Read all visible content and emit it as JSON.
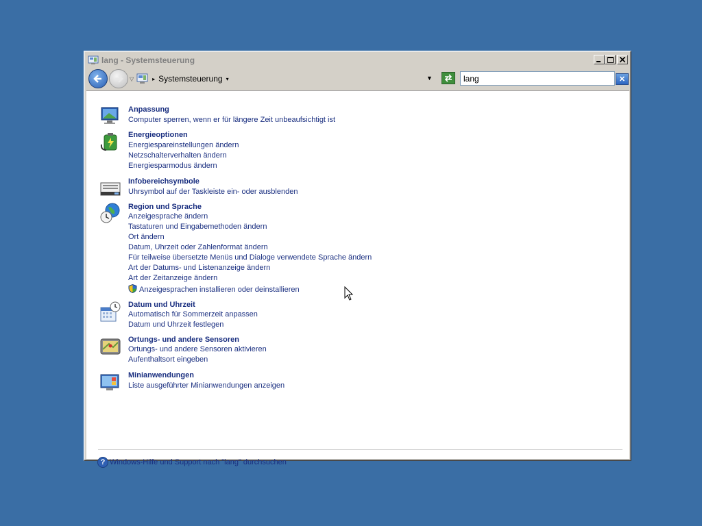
{
  "window": {
    "title": "lang - Systemsteuerung",
    "title_buttons": [
      "minimize",
      "maximize",
      "close"
    ]
  },
  "address": {
    "breadcrumb": "Systemsteuerung",
    "search_value": "lang"
  },
  "categories": [
    {
      "icon": "personalization-monitor-icon",
      "title": "Anpassung",
      "tasks": [
        "Computer sperren, wenn er für längere Zeit unbeaufsichtigt ist"
      ]
    },
    {
      "icon": "power-battery-icon",
      "title": "Energieoptionen",
      "tasks": [
        "Energiespareinstellungen ändern",
        "Netzschalterverhalten ändern",
        "Energiesparmodus ändern"
      ]
    },
    {
      "icon": "notification-area-icon",
      "title": "Infobereichsymbole",
      "tasks": [
        "Uhrsymbol auf der Taskleiste ein- oder ausblenden"
      ]
    },
    {
      "icon": "globe-clock-icon",
      "title": "Region und Sprache",
      "tasks": [
        "Anzeigesprache ändern",
        "Tastaturen und Eingabemethoden ändern",
        "Ort ändern",
        "Datum, Uhrzeit oder Zahlenformat ändern",
        "Für teilweise übersetzte Menüs und Dialoge verwendete Sprache ändern",
        "Art der Datums- und Listenanzeige ändern",
        "Art der Zeitanzeige ändern",
        "Anzeigesprachen installieren oder deinstallieren"
      ]
    },
    {
      "icon": "calendar-clock-icon",
      "title": "Datum und Uhrzeit",
      "tasks": [
        "Automatisch für Sommerzeit anpassen",
        "Datum und Uhrzeit festlegen"
      ]
    },
    {
      "icon": "location-sensor-icon",
      "title": "Ortungs- und andere Sensoren",
      "tasks": [
        "Ortungs- und andere Sensoren aktivieren",
        "Aufenthaltsort eingeben"
      ]
    },
    {
      "icon": "gadgets-icon",
      "title": "Minianwendungen",
      "tasks": [
        "Liste ausgeführter Minianwendungen anzeigen"
      ]
    }
  ],
  "help_link": "Windows-Hilfe und Support nach \"lang\" durchsuchen",
  "colors": {
    "desktop": "#3a6ea5",
    "link": "#1a2f80",
    "window_face": "#d4d0c8"
  }
}
